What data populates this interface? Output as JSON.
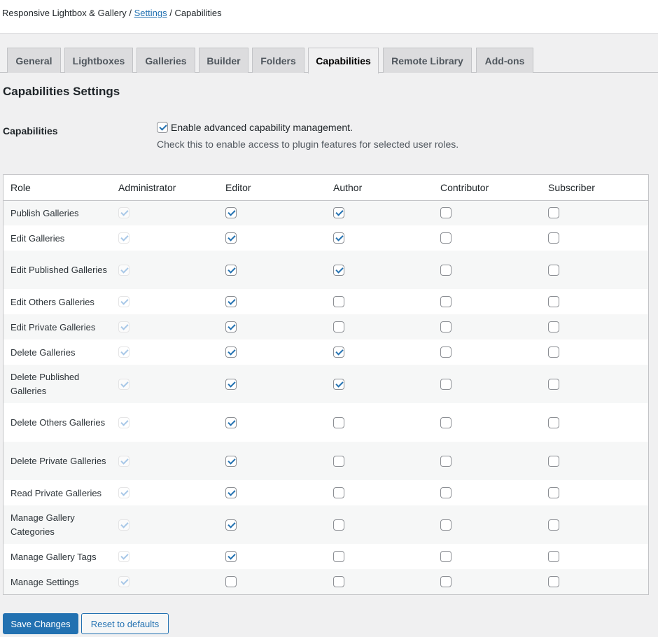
{
  "breadcrumb": {
    "plugin": "Responsive Lightbox & Gallery",
    "separator": " / ",
    "settings": "Settings",
    "current": "Capabilities"
  },
  "tabs": [
    {
      "label": "General",
      "active": false
    },
    {
      "label": "Lightboxes",
      "active": false
    },
    {
      "label": "Galleries",
      "active": false
    },
    {
      "label": "Builder",
      "active": false
    },
    {
      "label": "Folders",
      "active": false
    },
    {
      "label": "Capabilities",
      "active": true
    },
    {
      "label": "Remote Library",
      "active": false
    },
    {
      "label": "Add-ons",
      "active": false
    }
  ],
  "section_title": "Capabilities Settings",
  "capabilities_field": {
    "label": "Capabilities",
    "checkbox_label": "Enable advanced capability management.",
    "checked": true,
    "description": "Check this to enable access to plugin features for selected user roles."
  },
  "table": {
    "columns": [
      "Role",
      "Administrator",
      "Editor",
      "Author",
      "Contributor",
      "Subscriber"
    ],
    "rows": [
      {
        "label": "Publish Galleries",
        "values": [
          true,
          true,
          true,
          false,
          false
        ]
      },
      {
        "label": "Edit Galleries",
        "values": [
          true,
          true,
          true,
          false,
          false
        ]
      },
      {
        "label": "Edit Published Galleries",
        "values": [
          true,
          true,
          true,
          false,
          false
        ]
      },
      {
        "label": "Edit Others Galleries",
        "values": [
          true,
          true,
          false,
          false,
          false
        ]
      },
      {
        "label": "Edit Private Galleries",
        "values": [
          true,
          true,
          false,
          false,
          false
        ]
      },
      {
        "label": "Delete Galleries",
        "values": [
          true,
          true,
          true,
          false,
          false
        ]
      },
      {
        "label": "Delete Published Galleries",
        "values": [
          true,
          true,
          true,
          false,
          false
        ]
      },
      {
        "label": "Delete Others Galleries",
        "values": [
          true,
          true,
          false,
          false,
          false
        ]
      },
      {
        "label": "Delete Private Galleries",
        "values": [
          true,
          true,
          false,
          false,
          false
        ]
      },
      {
        "label": "Read Private Galleries",
        "values": [
          true,
          true,
          false,
          false,
          false
        ]
      },
      {
        "label": "Manage Gallery Categories",
        "values": [
          true,
          true,
          false,
          false,
          false
        ]
      },
      {
        "label": "Manage Gallery Tags",
        "values": [
          true,
          true,
          false,
          false,
          false
        ]
      },
      {
        "label": "Manage Settings",
        "values": [
          true,
          false,
          false,
          false,
          false
        ]
      }
    ]
  },
  "buttons": {
    "save": "Save Changes",
    "reset": "Reset to defaults"
  },
  "colors": {
    "accent": "#2271b1",
    "background": "#f0f0f1"
  }
}
